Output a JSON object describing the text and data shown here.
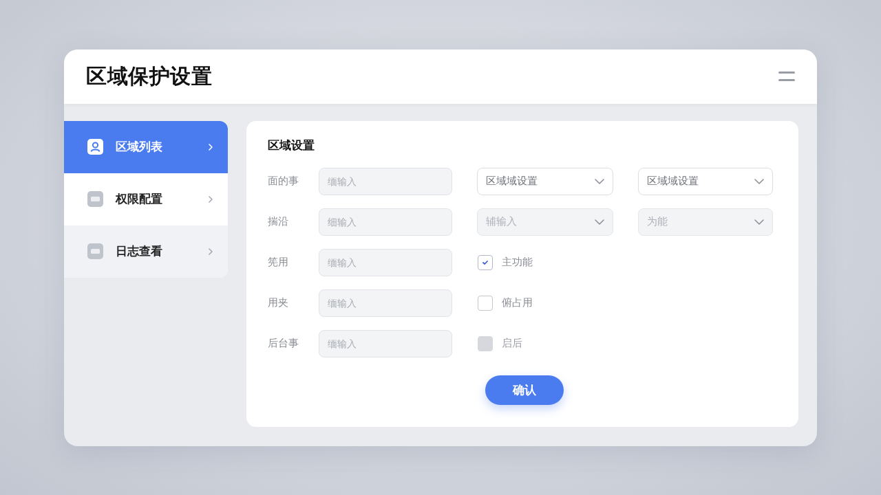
{
  "window": {
    "title": "区域保护设置"
  },
  "sidebar": {
    "items": [
      {
        "label": "区域列表",
        "selected": true,
        "hovered": false
      },
      {
        "label": "权限配置",
        "selected": false,
        "hovered": true
      },
      {
        "label": "日志查看",
        "selected": false,
        "hovered": false
      }
    ]
  },
  "panel": {
    "title": "区域设置",
    "rows": [
      {
        "label": "面的事",
        "placeholder": "缅输入",
        "extras": [
          {
            "kind": "select",
            "value": "区域域设置",
            "disabled": false
          },
          {
            "kind": "select",
            "value": "区域域设置",
            "disabled": false
          }
        ]
      },
      {
        "label": "揣沿",
        "placeholder": "细输入",
        "extras": [
          {
            "kind": "select",
            "value": "辅输入",
            "disabled": true
          },
          {
            "kind": "select",
            "value": "为能",
            "disabled": true
          }
        ]
      },
      {
        "label": "筅用",
        "placeholder": "缅输入",
        "extras": [
          {
            "kind": "checkbox",
            "label": "主功能",
            "checked": true,
            "disabled": false
          }
        ]
      },
      {
        "label": "用夹",
        "placeholder": "缅输入",
        "extras": [
          {
            "kind": "checkbox",
            "label": "俯占用",
            "checked": false,
            "disabled": false
          }
        ]
      },
      {
        "label": "后台事",
        "placeholder": "缅输入",
        "extras": [
          {
            "kind": "checkbox",
            "label": "启后",
            "checked": false,
            "disabled": true
          }
        ]
      }
    ],
    "submit": "确认"
  }
}
